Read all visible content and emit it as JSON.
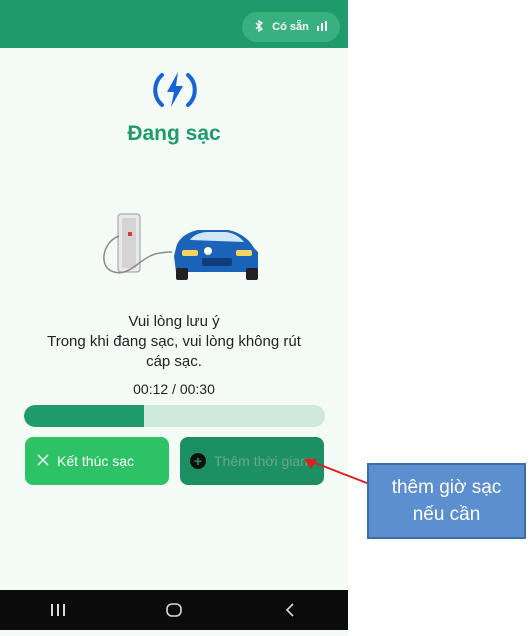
{
  "header": {
    "status_label": "Có sẵn",
    "bluetooth_icon": "bluetooth-icon",
    "signal_icon": "signal-icon"
  },
  "main": {
    "title": "Đang sạc",
    "notice_line1": "Vui lòng lưu ý",
    "notice_line2": "Trong khi đang sạc, vui lòng không rút",
    "notice_line3": "cáp sạc.",
    "timer": "00:12 / 00:30",
    "progress_fraction": 0.4,
    "end_button_label": "Kết thúc sạc",
    "add_time_button_label": "Thêm thời gian"
  },
  "annotation": {
    "line1": "thêm giờ sạc",
    "line2": "nếu cần"
  },
  "colors": {
    "accent": "#1f9a6b",
    "end_button": "#2ec267",
    "callout": "#5b8fd0",
    "arrow": "#e01e1e"
  }
}
